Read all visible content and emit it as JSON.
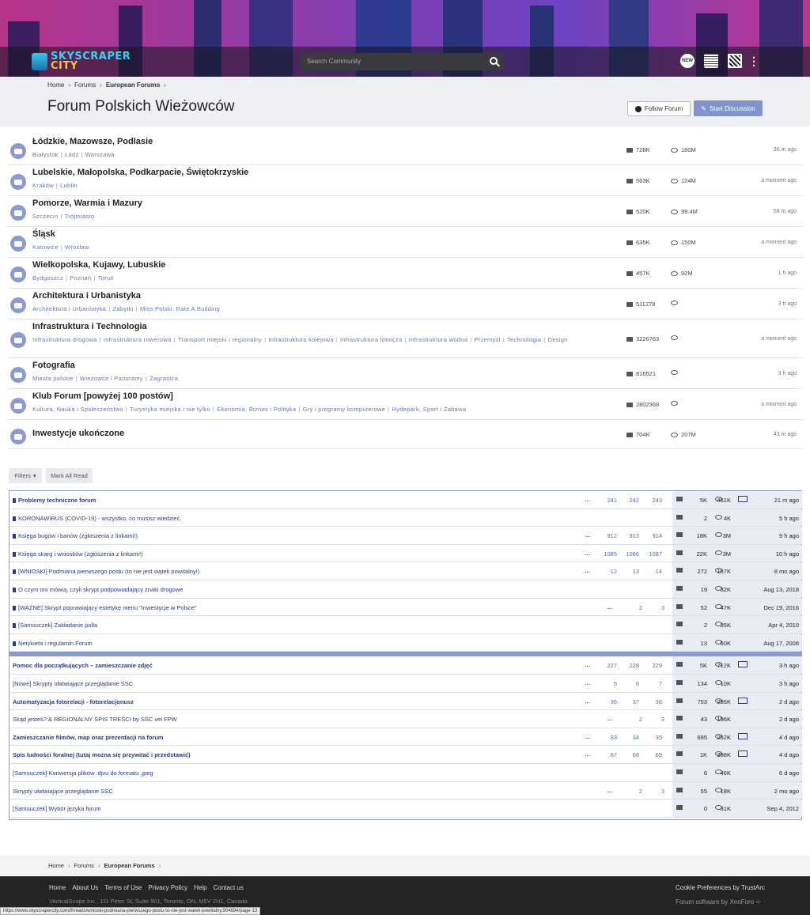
{
  "header": {
    "logo_line1": "SKYSCRAPER",
    "logo_line2": "CITY",
    "search_placeholder": "Search Community",
    "new_badge": "NEW"
  },
  "breadcrumb": [
    "Home",
    "Forums",
    "European Forums"
  ],
  "page_title": "Forum Polskich Wieżowców",
  "buttons": {
    "follow": "Follow Forum",
    "start": "Start Discussion"
  },
  "nodes": [
    {
      "title": "Łódzkie, Mazowsze, Podlasie",
      "subs": [
        "Białystok",
        "Łódź",
        "Warszawa"
      ],
      "messages": "728K",
      "views": "180M",
      "time": "36 m ago"
    },
    {
      "title": "Lubelskie, Małopolska, Podkarpacie, Świętokrzyskie",
      "subs": [
        "Kraków",
        "Lublin"
      ],
      "messages": "563K",
      "views": "124M",
      "time": "a moment ago"
    },
    {
      "title": "Pomorze, Warmia i Mazury",
      "subs": [
        "Szczecin",
        "Trójmiasto"
      ],
      "messages": "520K",
      "views": "99.4M",
      "time": "58 m ago"
    },
    {
      "title": "Śląsk",
      "subs": [
        "Katowice",
        "Wrocław"
      ],
      "messages": "635K",
      "views": "150M",
      "time": "a moment ago"
    },
    {
      "title": "Wielkopolska, Kujawy, Lubuskie",
      "subs": [
        "Bydgoszcz",
        "Poznań",
        "Toruń"
      ],
      "messages": "457K",
      "views": "92M",
      "time": "1 h ago"
    },
    {
      "title": "Architektura i Urbanistyka",
      "subs": [
        "Architektura i Urbanistyka",
        "Zabytki",
        "Miss Polski: Rate A Building"
      ],
      "messages": "511278",
      "views": "",
      "time": "3 h ago"
    },
    {
      "title": "Infrastruktura i Technologia",
      "subs": [
        "Infrastruktura drogowa",
        "Infrastruktura rowerowa",
        "Transport miejski i regionalny",
        "Infrastruktura kolejowa",
        "Infrastruktura lotnicza",
        "Infrastruktura wodna",
        "Przemysł",
        "Technologia",
        "Design"
      ],
      "messages": "3226763",
      "views": "",
      "time": "a moment ago"
    },
    {
      "title": "Fotografia",
      "subs": [
        "Miasta polskie",
        "Wieżowce i Panoramy",
        "Zagranica"
      ],
      "messages": "816521",
      "views": "",
      "time": "3 h ago"
    },
    {
      "title": "Klub Forum [powyżej 100 postów]",
      "subs": [
        "Kultura, Nauka i Społeczeństwo",
        "Turystyka miejska i nie tylko",
        "Ekonomia, Biznes i Polityka",
        "Gry i programy komputerowe",
        "Hydepark, Sport i Zabawa"
      ],
      "messages": "2802368",
      "views": "",
      "time": "a moment ago"
    },
    {
      "title": "Inwestycje ukończone",
      "subs": [],
      "messages": "704K",
      "views": "207M",
      "time": "43 m ago"
    }
  ],
  "filters": {
    "filters": "Filters",
    "mark_read": "Mark All Read"
  },
  "sticky_threads": [
    {
      "title": "Problemy techniczne forum",
      "bold": true,
      "pages": [
        "241",
        "242",
        "243"
      ],
      "replies": "5K",
      "views": "461K",
      "env": true,
      "time": "21 m ago"
    },
    {
      "title": "KORONAWIRUS (COVID-19) - wszystko, co musisz wiedzieć.",
      "bold": false,
      "pages": [],
      "replies": "2",
      "views": "4K",
      "env": false,
      "time": "5 h ago"
    },
    {
      "title": "Księga bugów i banów (zgłoszenia z linkami!)",
      "bold": false,
      "pages": [
        "912",
        "913",
        "914"
      ],
      "replies": "18K",
      "views": "3M",
      "env": false,
      "time": "9 h ago"
    },
    {
      "title": "Księga skarg i wniosków (zgłoszenia z linkami!)",
      "bold": false,
      "pages": [
        "1085",
        "1086",
        "1087"
      ],
      "replies": "22K",
      "views": "3M",
      "env": false,
      "time": "10 h ago"
    },
    {
      "title": "[WNIOSKI] Podmiana pierwszego postu (to nie jest wątek powitalny!)",
      "bold": false,
      "pages": [
        "12",
        "13",
        "14"
      ],
      "replies": "272",
      "views": "187K",
      "env": false,
      "time": "8 mo ago"
    },
    {
      "title": "O czym oni mówią, czyli skrypt podpowiadający znaki drogowe",
      "bold": false,
      "pages": [],
      "replies": "19",
      "views": "32K",
      "env": false,
      "time": "Aug 13, 2018"
    },
    {
      "title": "[WAŻNE] Skrypt poprawiający estetykę menu \"Inwestycje w Polsce\"",
      "bold": false,
      "pages": [
        "2",
        "3"
      ],
      "replies": "52",
      "views": "47K",
      "env": false,
      "time": "Dec 19, 2016"
    },
    {
      "title": "[Samouczek] Zakładanie polla",
      "bold": false,
      "pages": [],
      "replies": "2",
      "views": "35K",
      "env": false,
      "time": "Apr 4, 2010"
    },
    {
      "title": "Netykieta i regulamin Forum",
      "bold": false,
      "pages": [],
      "replies": "13",
      "views": "60K",
      "env": false,
      "time": "Aug 17, 2008"
    }
  ],
  "threads": [
    {
      "title": "Pomoc dla początkujących – zamieszczanie zdjęć",
      "bold": true,
      "pages": [
        "227",
        "228",
        "229"
      ],
      "replies": "5K",
      "views": "712K",
      "env": true,
      "time": "3 h ago"
    },
    {
      "title": "[Nowe] Skrypty ułatwiające przeglądanie SSC",
      "bold": false,
      "pages": [
        "5",
        "6",
        "7"
      ],
      "replies": "134",
      "views": "10K",
      "env": false,
      "time": "3 h ago"
    },
    {
      "title": "Automatyzacja fotorelacji - fotorelacjonusz",
      "bold": true,
      "pages": [
        "36",
        "37",
        "38"
      ],
      "replies": "753",
      "views": "295K",
      "env": true,
      "time": "2 d ago"
    },
    {
      "title": "Skąd jesteś? & REGIONALNY SPIS TREŚCI by SSC vel FPW",
      "bold": false,
      "pages": [
        "2",
        "3"
      ],
      "replies": "43",
      "views": "196K",
      "env": false,
      "time": "2 d ago"
    },
    {
      "title": "Zamieszczanie filmów, map oraz prezentacji na forum",
      "bold": true,
      "pages": [
        "33",
        "34",
        "35"
      ],
      "replies": "695",
      "views": "252K",
      "env": true,
      "time": "4 d ago"
    },
    {
      "title": "Spis ludności foralnej (tutaj można się przywitać i przedstawić)",
      "bold": true,
      "pages": [
        "67",
        "68",
        "69"
      ],
      "replies": "1K",
      "views": "398K",
      "env": true,
      "time": "4 d ago"
    },
    {
      "title": "[Samouczek] Konwersja plików .djvu do formatu .jpeg",
      "bold": false,
      "pages": [],
      "replies": "6",
      "views": "46K",
      "env": false,
      "time": "6 d ago"
    },
    {
      "title": "Skrypty ułatwiające przeglądanie SSC",
      "bold": false,
      "pages": [
        "2",
        "3"
      ],
      "replies": "55",
      "views": "18K",
      "env": false,
      "time": "2 mo ago"
    },
    {
      "title": "[Samouczek] Wybór języka forum",
      "bold": false,
      "pages": [],
      "replies": "0",
      "views": "31K",
      "env": false,
      "time": "Sep 4, 2012"
    }
  ],
  "footer": {
    "links": [
      "Home",
      "About Us",
      "Terms of Use",
      "Privacy Policy",
      "Help",
      "Contact us"
    ],
    "address": "VerticalScope Inc., 111 Peter St, Suite 901, Toronto, ON, M5V 2H1, Canada",
    "cookie": "Cookie Preferences by TrustArc",
    "software": "Forum software by XenForo ⊹",
    "status_url": "https://www.skyscrapercity.com/threads/wnioski-podmiana-pierwszego-postu-to-nie-jest-watek-powitalny.904694/page-13"
  },
  "ellipsis": "…"
}
